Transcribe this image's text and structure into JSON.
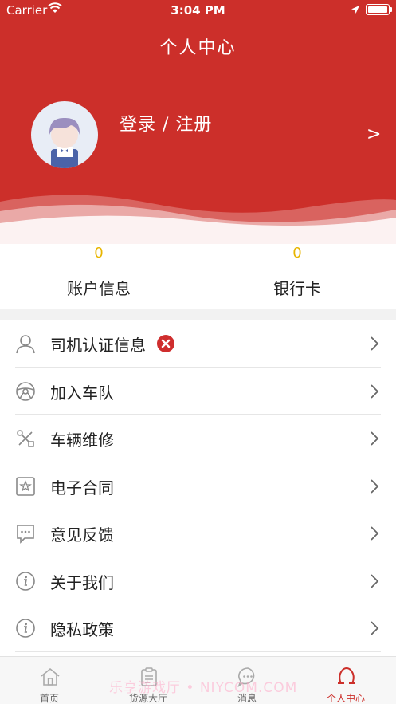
{
  "status_bar": {
    "carrier": "Carrier",
    "time": "3:04 PM"
  },
  "header": {
    "title": "个人中心",
    "login_text": "登录 / 注册",
    "chevron": ">"
  },
  "stats": [
    {
      "value": "0",
      "label": "账户信息"
    },
    {
      "value": "0",
      "label": "银行卡"
    }
  ],
  "menu": [
    {
      "label": "司机认证信息",
      "icon": "user-icon",
      "badge": "error-x"
    },
    {
      "label": "加入车队",
      "icon": "steering-wheel-icon"
    },
    {
      "label": "车辆维修",
      "icon": "tools-icon"
    },
    {
      "label": "电子合同",
      "icon": "contract-icon"
    },
    {
      "label": "意见反馈",
      "icon": "feedback-icon"
    },
    {
      "label": "关于我们",
      "icon": "info-icon"
    },
    {
      "label": "隐私政策",
      "icon": "info-icon"
    }
  ],
  "tabs": [
    {
      "label": "首页",
      "icon": "home-icon",
      "active": false
    },
    {
      "label": "货源大厅",
      "icon": "clipboard-icon",
      "active": false
    },
    {
      "label": "消息",
      "icon": "message-icon",
      "active": false
    },
    {
      "label": "个人中心",
      "icon": "profile-icon",
      "active": true
    }
  ],
  "watermark": "乐享游戏厅 • NIYCOM.COM",
  "colors": {
    "brand_red": "#cc2f2a",
    "stat_yellow": "#e8b500",
    "badge_red": "#cf2e2e"
  }
}
